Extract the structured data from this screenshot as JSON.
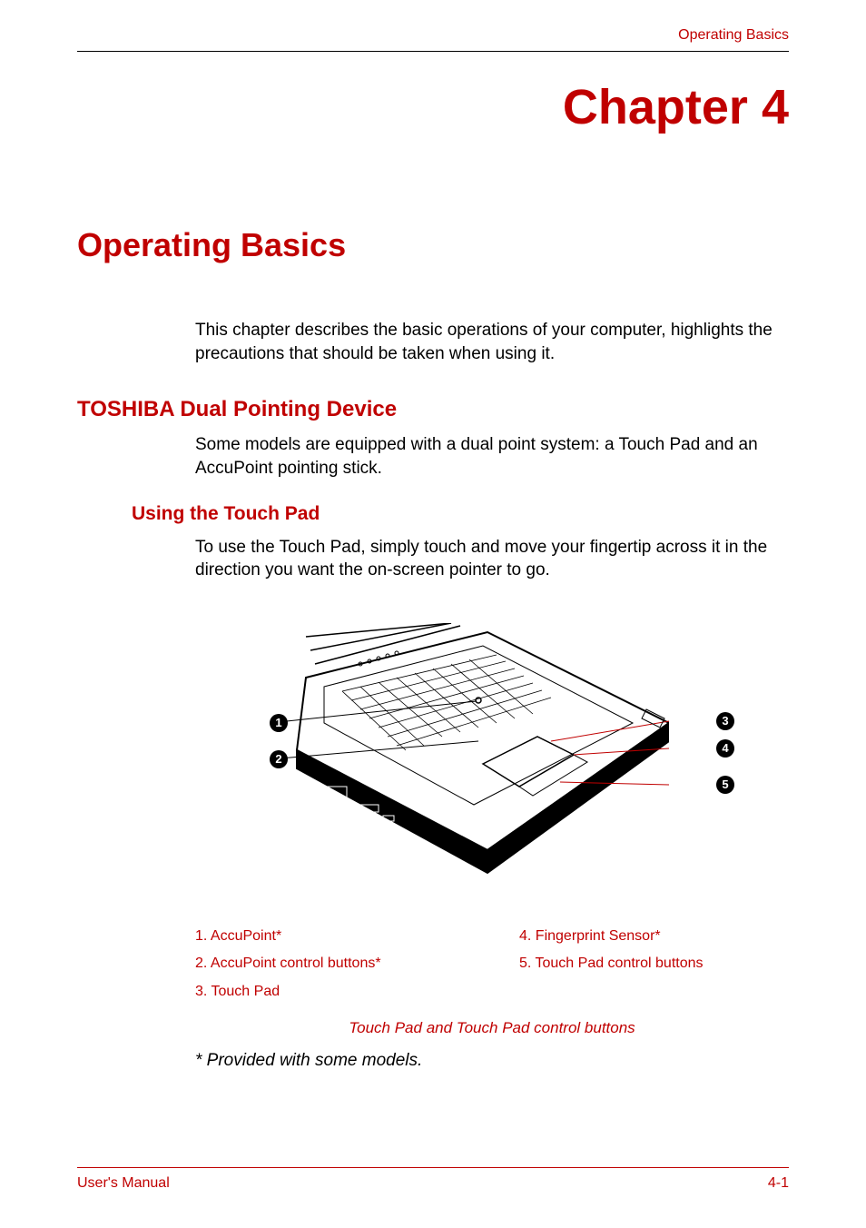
{
  "header": {
    "page_header": "Operating Basics"
  },
  "chapter": {
    "title": "Chapter 4"
  },
  "section": {
    "title": "Operating Basics",
    "intro": "This chapter describes the basic operations of your computer, highlights the precautions that should be taken when using it."
  },
  "subsection": {
    "title": "TOSHIBA Dual Pointing Device",
    "text": "Some models are equipped with a dual point system: a Touch Pad and an AccuPoint pointing stick."
  },
  "subsubsection": {
    "title": "Using the Touch Pad",
    "text": "To use the Touch Pad, simply touch and move your fingertip across it in the direction you want the on-screen pointer to go."
  },
  "diagram": {
    "markers": {
      "m1": "1",
      "m2": "2",
      "m3": "3",
      "m4": "4",
      "m5": "5"
    },
    "legend": {
      "item1": "1. AccuPoint*",
      "item2": "2. AccuPoint control buttons*",
      "item3": "3. Touch Pad",
      "item4": "4. Fingerprint Sensor*",
      "item5": "5. Touch Pad control buttons"
    },
    "caption": "Touch Pad and Touch Pad control buttons"
  },
  "footnote": {
    "text": "* Provided with some models."
  },
  "footer": {
    "left": "User's Manual",
    "right": "4-1"
  }
}
